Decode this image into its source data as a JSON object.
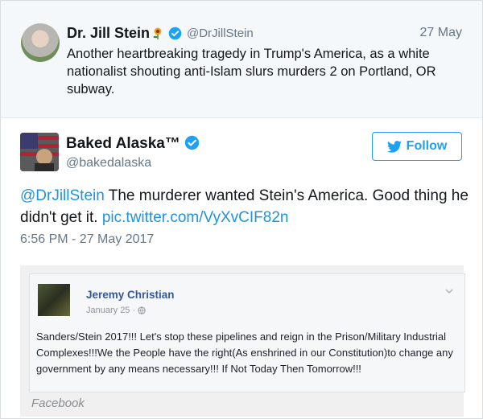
{
  "quoted_tweet": {
    "name": "Dr. Jill Stein",
    "handle": "@DrJillStein",
    "date": "27 May",
    "text": "Another heartbreaking tragedy in Trump's America, as a white nationalist shouting anti-Islam slurs murders 2 on Portland, OR subway.",
    "icons": [
      "sunflower-emoji-icon",
      "verified-badge-icon"
    ]
  },
  "tweet": {
    "name": "Baked Alaska™",
    "handle": "@bakedalaska",
    "mention": "@DrJillStein",
    "text": " The murderer wanted Stein's America. Good thing he didn't get it. ",
    "link": "pic.twitter.com/VyXvCIF82n",
    "timestamp": "6:56 PM - 27 May 2017",
    "follow_label": "Follow",
    "icons": [
      "verified-badge-icon",
      "twitter-bird-icon"
    ]
  },
  "facebook_post": {
    "author": "Jeremy Christian",
    "date": "January 25 ·",
    "text": "Sanders/Stein 2017!!! Let's stop these pipelines and reign in the Prison/Military Industrial Complexes!!!We the People have the right(As enshrined in our Constitution)to change any government by any means necessary!!! If Not Today Then Tomorrow!!!",
    "source_label": "Facebook",
    "icons": [
      "globe-icon",
      "chevron-down-icon"
    ]
  },
  "colors": {
    "twitter_blue": "#1da1f2",
    "link_blue": "#1b95e0",
    "muted_gray": "#657786",
    "fb_blue": "#365899",
    "quoted_bg": "#f5f8fa"
  }
}
